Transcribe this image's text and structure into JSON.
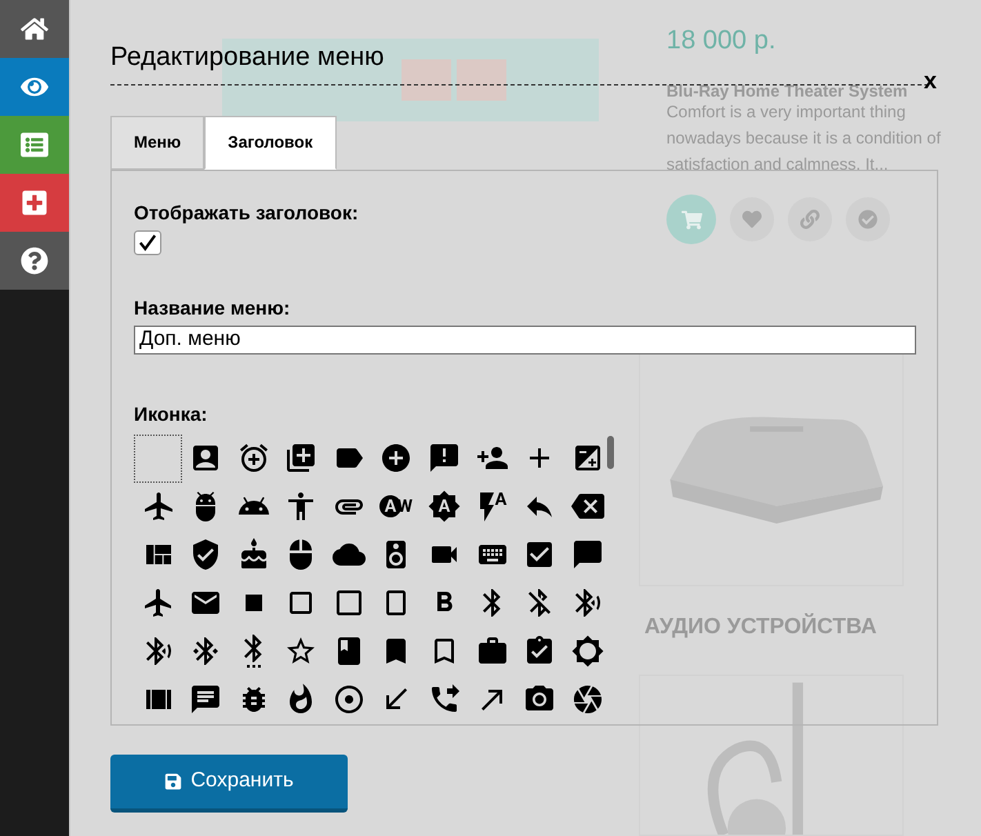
{
  "sidebar": {
    "items": [
      {
        "kind": "home",
        "color": "#555555"
      },
      {
        "kind": "view",
        "color": "#0a7bbd"
      },
      {
        "kind": "list",
        "color": "#4c9a3c"
      },
      {
        "kind": "add",
        "color": "#d63c40"
      },
      {
        "kind": "help",
        "color": "#555555"
      }
    ]
  },
  "background": {
    "price": "18 000 р.",
    "product_title": "Blu-Ray Home Theater System",
    "description": "Comfort is a very important thing nowadays because it is a condition of satisfaction and calmness. It...",
    "category": "АУДИО УСТРОЙСТВА"
  },
  "modal": {
    "title": "Редактирование меню",
    "close": "x",
    "tabs": [
      {
        "label": "Меню",
        "selected": false
      },
      {
        "label": "Заголовок",
        "selected": true
      }
    ],
    "show_title": {
      "label": "Отображать заголовок:",
      "checked": true
    },
    "menu_name": {
      "label": "Название меню:",
      "value": "Доп. меню"
    },
    "icon": {
      "label": "Иконка:",
      "options": [
        {
          "selected": true
        },
        {
          "selected": false
        },
        {
          "selected": false
        },
        {
          "selected": false
        },
        {
          "selected": false
        },
        {
          "selected": false
        },
        {
          "selected": false
        },
        {
          "selected": false
        },
        {
          "selected": false
        },
        {
          "selected": false
        },
        {
          "selected": false
        },
        {
          "selected": false
        },
        {
          "selected": false
        },
        {
          "selected": false
        },
        {
          "selected": false
        },
        {
          "selected": false
        },
        {
          "selected": false
        },
        {
          "selected": false
        },
        {
          "selected": false
        },
        {
          "selected": false
        },
        {
          "selected": false
        },
        {
          "selected": false
        },
        {
          "selected": false
        },
        {
          "selected": false
        },
        {
          "selected": false
        },
        {
          "selected": false
        },
        {
          "selected": false
        },
        {
          "selected": false
        },
        {
          "selected": false
        },
        {
          "selected": false
        },
        {
          "selected": false
        },
        {
          "selected": false
        },
        {
          "selected": false
        },
        {
          "selected": false
        },
        {
          "selected": false
        },
        {
          "selected": false
        },
        {
          "selected": false
        },
        {
          "selected": false
        },
        {
          "selected": false
        },
        {
          "selected": false
        },
        {
          "selected": false
        },
        {
          "selected": false
        },
        {
          "selected": false
        },
        {
          "selected": false
        },
        {
          "selected": false
        },
        {
          "selected": false
        },
        {
          "selected": false
        },
        {
          "selected": false
        },
        {
          "selected": false
        },
        {
          "selected": false
        },
        {
          "selected": false
        },
        {
          "selected": false
        },
        {
          "selected": false
        },
        {
          "selected": false
        },
        {
          "selected": false
        },
        {
          "selected": false
        },
        {
          "selected": false
        },
        {
          "selected": false
        },
        {
          "selected": false
        },
        {
          "selected": false
        }
      ]
    },
    "save_button": "Сохранить"
  }
}
